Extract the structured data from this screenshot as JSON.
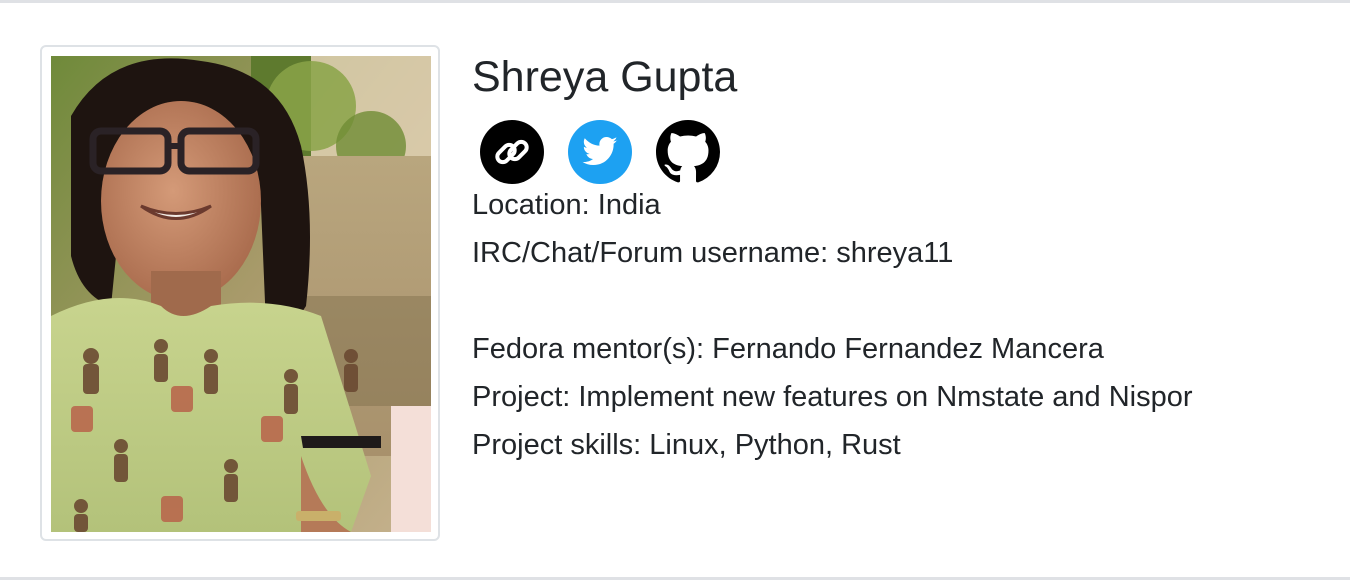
{
  "profile": {
    "name": "Shreya Gupta",
    "photo_alt": "Photo of Shreya Gupta",
    "social": {
      "website_icon": "link-icon",
      "twitter_icon": "twitter-icon",
      "github_icon": "github-icon"
    },
    "location": "Location: India",
    "username": "IRC/Chat/Forum username: shreya11",
    "mentors": "Fedora mentor(s): Fernando Fernandez Mancera",
    "project": "Project: Implement new features on Nmstate and Nispor",
    "skills": "Project skills: Linux, Python, Rust"
  },
  "colors": {
    "twitter": "#1da1f2",
    "link_bg": "#000000",
    "border": "#dfe1e5",
    "text": "#212529"
  }
}
